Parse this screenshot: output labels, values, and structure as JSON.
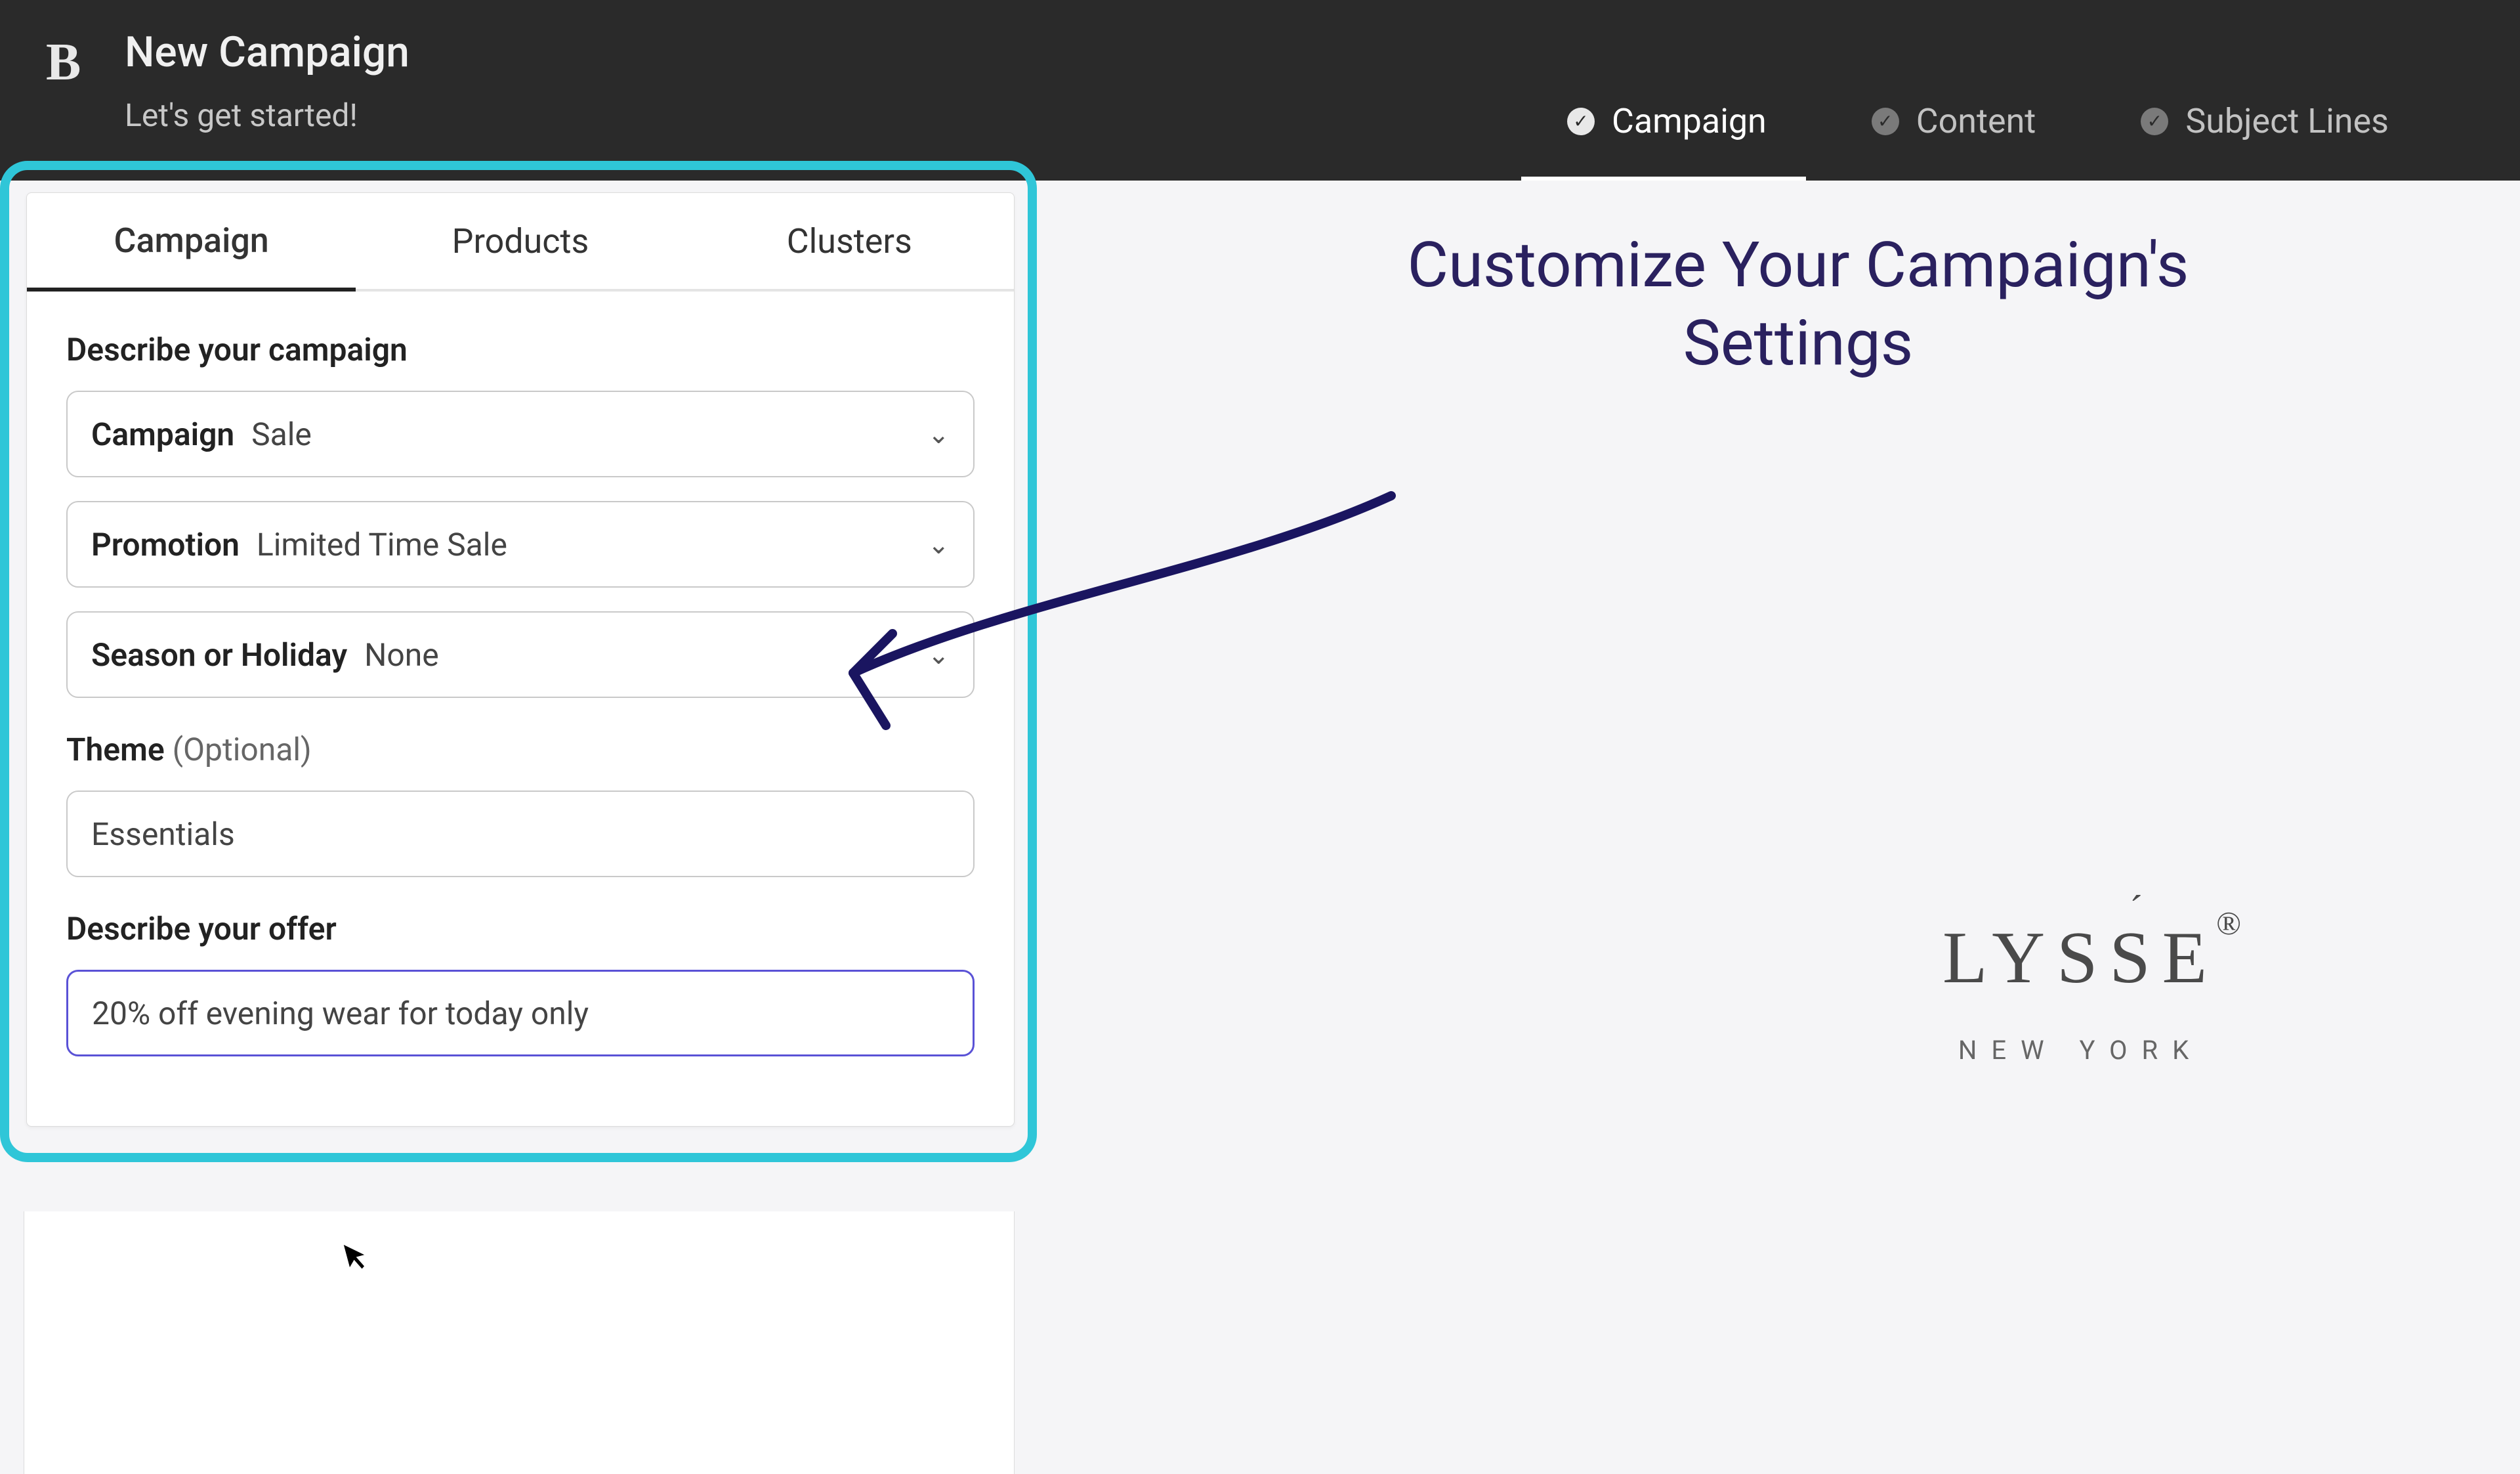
{
  "header": {
    "logo": "B",
    "title": "New Campaign",
    "subtitle": "Let's get started!",
    "steps": [
      {
        "label": "Campaign",
        "active": true
      },
      {
        "label": "Content",
        "active": false
      },
      {
        "label": "Subject Lines",
        "active": false
      }
    ]
  },
  "panel": {
    "tabs": [
      {
        "label": "Campaign",
        "active": true
      },
      {
        "label": "Products",
        "active": false
      },
      {
        "label": "Clusters",
        "active": false
      }
    ],
    "describe_label": "Describe your campaign",
    "selects": [
      {
        "prefix": "Campaign",
        "value": "Sale"
      },
      {
        "prefix": "Promotion",
        "value": "Limited Time Sale"
      },
      {
        "prefix": "Season or Holiday",
        "value": "None"
      }
    ],
    "theme_label": "Theme",
    "theme_optional": "(Optional)",
    "theme_value": "Essentials",
    "offer_label": "Describe your offer",
    "offer_value": "20% off evening wear for today only"
  },
  "callout": "Customize Your Campaign's Settings",
  "brand": {
    "name": "LYSSE",
    "accent": "´",
    "reg": "®",
    "sub": "NEW YORK"
  },
  "colors": {
    "highlight_border": "#2fc6d8",
    "callout_text": "#2a215f",
    "active_input": "#5a52d6"
  }
}
